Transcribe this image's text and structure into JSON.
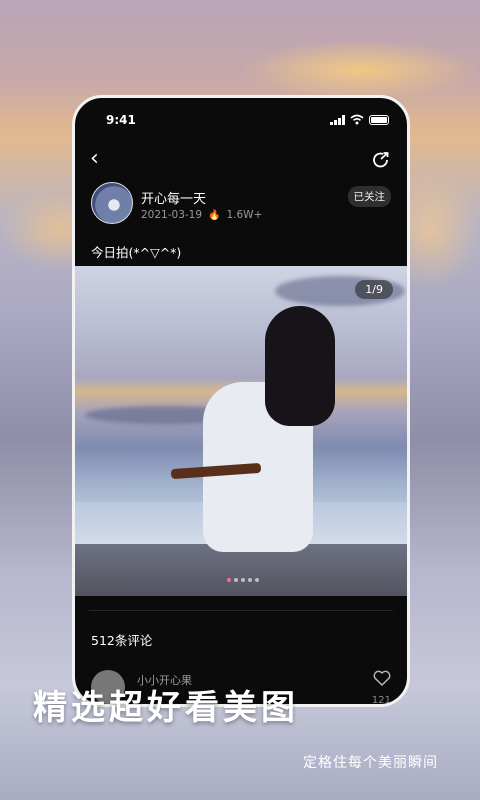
{
  "status_bar": {
    "time": "9:41"
  },
  "post": {
    "username": "开心每一天",
    "date": "2021-03-19",
    "heat": "1.6W+",
    "follow_label": "已关注",
    "caption": "今日拍(*^▽^*)",
    "image_counter": "1/9",
    "image_count": 9,
    "current_image": 1
  },
  "comments": {
    "count_label": "512条评论",
    "first_user": "小小开心果",
    "first_likes": "121"
  },
  "promo": {
    "headline": "精选超好看美图",
    "subline": "定格住每个美丽瞬间"
  },
  "icons": [
    "back-icon",
    "share-icon",
    "signal-icon",
    "wifi-icon",
    "battery-icon",
    "flame-icon",
    "heart-icon"
  ],
  "colors": {
    "phone_bg": "#0b0b0b",
    "accent_dot": "#ff6b8b"
  }
}
